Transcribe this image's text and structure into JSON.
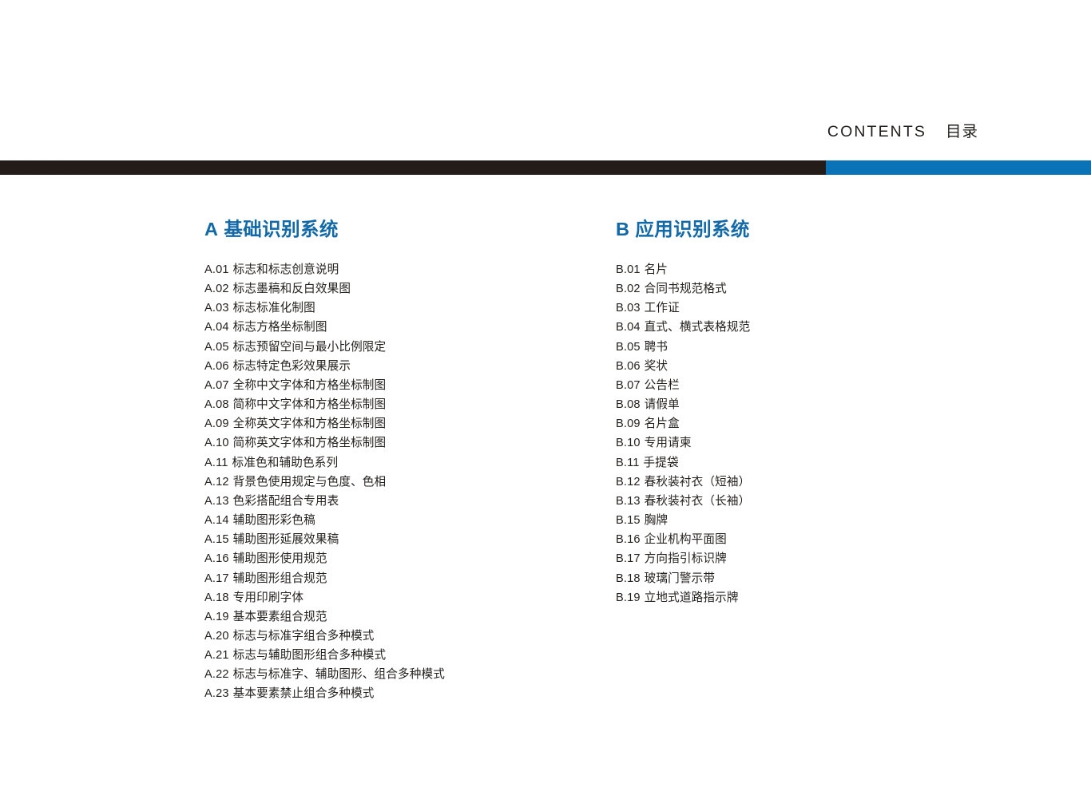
{
  "header": {
    "contents_label": "CONTENTS",
    "contents_label_cn": "目录"
  },
  "colors": {
    "rule_dark": "#231c18",
    "rule_blue": "#0a72b6",
    "heading_blue": "#1269a8",
    "body_text": "#231f1d",
    "page_background": "#ffffff"
  },
  "columns": [
    {
      "letter": "A",
      "title": "基础识别系统",
      "items": [
        {
          "code": "A.01",
          "label": "标志和标志创意说明"
        },
        {
          "code": "A.02",
          "label": "标志墨稿和反白效果图"
        },
        {
          "code": "A.03",
          "label": "标志标准化制图"
        },
        {
          "code": "A.04",
          "label": "标志方格坐标制图"
        },
        {
          "code": "A.05",
          "label": "标志预留空间与最小比例限定"
        },
        {
          "code": "A.06",
          "label": "标志特定色彩效果展示"
        },
        {
          "code": "A.07",
          "label": "全称中文字体和方格坐标制图"
        },
        {
          "code": "A.08",
          "label": "简称中文字体和方格坐标制图"
        },
        {
          "code": "A.09",
          "label": "全称英文字体和方格坐标制图"
        },
        {
          "code": "A.10",
          "label": "简称英文字体和方格坐标制图"
        },
        {
          "code": "A.11",
          "label": "标准色和辅助色系列"
        },
        {
          "code": "A.12",
          "label": "背景色使用规定与色度、色相"
        },
        {
          "code": "A.13",
          "label": "色彩搭配组合专用表"
        },
        {
          "code": "A.14",
          "label": "辅助图形彩色稿"
        },
        {
          "code": "A.15",
          "label": "辅助图形延展效果稿"
        },
        {
          "code": "A.16",
          "label": "辅助图形使用规范"
        },
        {
          "code": "A.17",
          "label": "辅助图形组合规范"
        },
        {
          "code": "A.18",
          "label": "专用印刷字体"
        },
        {
          "code": "A.19",
          "label": "基本要素组合规范"
        },
        {
          "code": "A.20",
          "label": "标志与标准字组合多种模式"
        },
        {
          "code": "A.21",
          "label": "标志与辅助图形组合多种模式"
        },
        {
          "code": "A.22",
          "label": "标志与标准字、辅助图形、组合多种模式"
        },
        {
          "code": "A.23",
          "label": "基本要素禁止组合多种模式"
        }
      ]
    },
    {
      "letter": "B",
      "title": "应用识别系统",
      "items": [
        {
          "code": "B.01",
          "label": "名片"
        },
        {
          "code": "B.02",
          "label": "合同书规范格式"
        },
        {
          "code": "B.03",
          "label": "工作证"
        },
        {
          "code": "B.04",
          "label": "直式、横式表格规范"
        },
        {
          "code": "B.05",
          "label": "聘书"
        },
        {
          "code": "B.06",
          "label": "奖状"
        },
        {
          "code": "B.07",
          "label": "公告栏"
        },
        {
          "code": "B.08",
          "label": "请假单"
        },
        {
          "code": "B.09",
          "label": "名片盒"
        },
        {
          "code": "B.10",
          "label": "专用请柬"
        },
        {
          "code": "B.11",
          "label": "手提袋"
        },
        {
          "code": "B.12",
          "label": "春秋装衬衣（短袖）"
        },
        {
          "code": "B.13",
          "label": "春秋装衬衣（长袖）"
        },
        {
          "code": "B.15",
          "label": "胸牌"
        },
        {
          "code": "B.16",
          "label": "企业机构平面图"
        },
        {
          "code": "B.17",
          "label": "方向指引标识牌"
        },
        {
          "code": "B.18",
          "label": "玻璃门警示带"
        },
        {
          "code": "B.19",
          "label": "立地式道路指示牌"
        }
      ]
    }
  ]
}
